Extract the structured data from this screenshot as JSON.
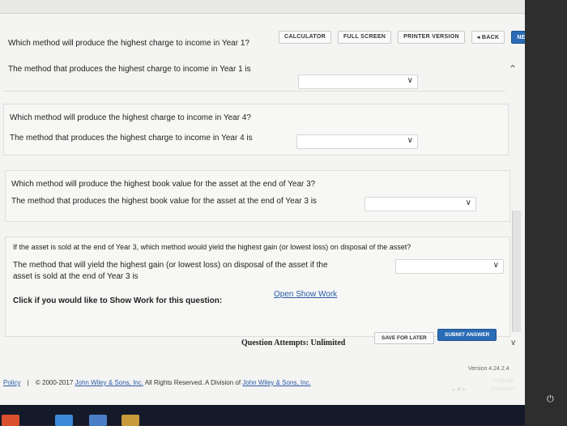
{
  "toolbar": {
    "calculator": "CALCULATOR",
    "full_screen": "FULL SCREEN",
    "printer_version": "PRINTER VERSION",
    "back": "◂ BACK",
    "next": "NEXT ▸"
  },
  "questions": [
    {
      "question": "Which method will produce the highest charge to income in Year 1?",
      "answer_label": "The method that produces the highest charge to income in Year 1 is"
    },
    {
      "question": "Which method will produce the highest charge to income in Year 4?",
      "answer_label": "The method that produces the highest charge to income in Year 4 is"
    },
    {
      "question": "Which method will produce the highest book value for the asset at the end of Year 3?",
      "answer_label": "The method that produces the highest book value for the asset at the end of Year 3 is"
    },
    {
      "question": "If the asset is sold at the end of Year 3, which method would yield the highest gain (or lowest loss) on disposal of the asset?",
      "answer_label_line1": "The method that will yield the highest gain (or lowest loss) on disposal of the asset if the",
      "answer_label_line2": "asset is sold at the end of Year 3 is"
    }
  ],
  "show_work": {
    "prompt": "Click if you would like to Show Work for this question:",
    "link": "Open Show Work"
  },
  "attempts": {
    "label": "Question Attempts: Unlimited"
  },
  "buttons": {
    "save_for_later": "SAVE FOR LATER",
    "submit_answer": "SUBMIT ANSWER"
  },
  "version": "Version 4.24.2.4",
  "footer": {
    "policy": "Policy",
    "separator": "|",
    "copyright_prefix": "© 2000-2017 ",
    "company_link": "John Wiley & Sons, Inc.",
    "rights": " All Rights Reserved. A Division of ",
    "division_link": "John Wiley & Sons, Inc."
  },
  "clock": {
    "time": "10:59 AM",
    "date": "11/13/2017"
  },
  "colors": {
    "next_button": "#2a6cb5",
    "submit_button": "#2a6cb5",
    "link": "#2a5aa8"
  }
}
